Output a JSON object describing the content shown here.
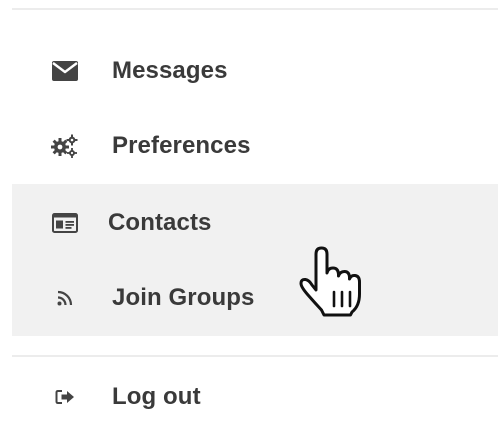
{
  "menu": {
    "items": [
      {
        "label": "Messages",
        "icon": "envelope-icon"
      },
      {
        "label": "Preferences",
        "icon": "gears-icon"
      },
      {
        "label": "Contacts",
        "icon": "id-card-icon"
      },
      {
        "label": "Join Groups",
        "icon": "rss-icon"
      },
      {
        "label": "Log out",
        "icon": "sign-out-icon"
      }
    ],
    "hovered_item": "Contacts"
  },
  "colors": {
    "text": "#3a3a3a",
    "icon": "#444444",
    "hover_background": "#f1f1f1",
    "divider": "#ececec",
    "background": "#ffffff"
  }
}
